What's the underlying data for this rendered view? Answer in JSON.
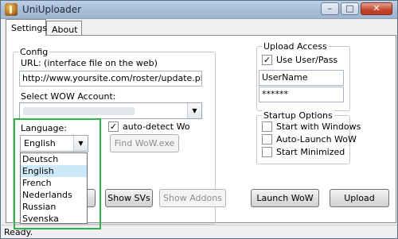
{
  "window": {
    "title": "UniUploader",
    "minimize": "–",
    "maximize": "□",
    "close": "✕"
  },
  "tabs": [
    {
      "label": "Settings"
    },
    {
      "label": "About"
    }
  ],
  "config": {
    "group_label": "Config",
    "url_label": "URL: (interface file on the web)",
    "url_value": "http://www.yoursite.com/roster/update.php",
    "account_label": "Select WOW Account:",
    "language_label": "Language:",
    "language_selected": "English",
    "autodetect_label": "auto-detect Wo",
    "autodetect_checked": true,
    "find_wow_button": "Find WoW.exe"
  },
  "language_options": [
    "Deutsch",
    "English",
    "French",
    "Nederlands",
    "Russian",
    "Svenska"
  ],
  "upload_access": {
    "group_label": "Upload Access",
    "use_userpass_label": "Use User/Pass",
    "use_userpass_checked": true,
    "username_value": "UserName",
    "password_value": "******"
  },
  "startup": {
    "group_label": "Startup Options",
    "options": [
      "Start with Windows",
      "Auto-Launch WoW",
      "Start Minimized"
    ]
  },
  "buttons": {
    "show_svs": "Show SVs",
    "show_addons": "Show Addons",
    "launch_wow": "Launch WoW",
    "upload": "Upload"
  },
  "status": {
    "text": "Ready."
  },
  "icons": {
    "app": "wow-logo-icon",
    "dropdown": "chevron-down-icon",
    "check": "checkmark-icon"
  }
}
